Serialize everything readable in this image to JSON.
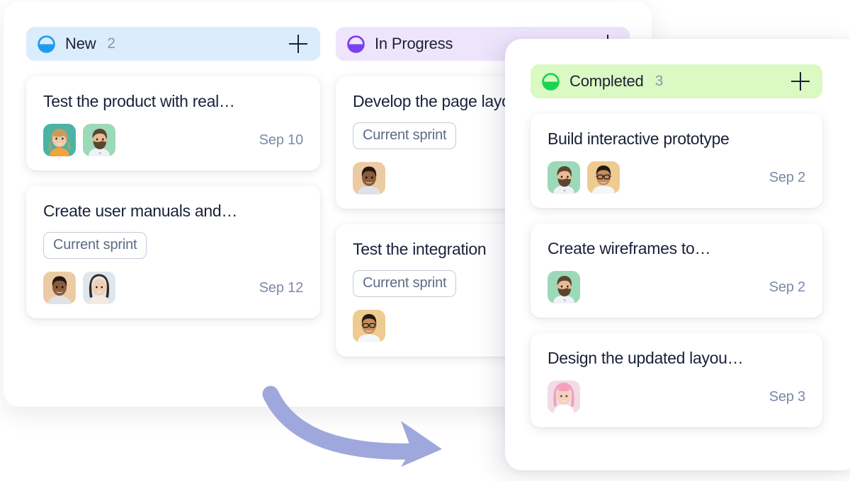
{
  "board": {
    "columns": [
      {
        "id": "new",
        "status_icon": "half-circle-status-icon",
        "accent": "#1e9bf0",
        "header_bg": "#dbecfd",
        "title": "New",
        "count": "2",
        "add_label": "+",
        "cards": [
          {
            "title": "Test the product with real…",
            "tag": null,
            "date": "Sep 10",
            "avatars": [
              {
                "name": "avatar-woman-blonde",
                "bg": "#4cb3a5",
                "skin": "#f1c9a8",
                "hair": "#c79a5e",
                "cloth": "#f2a33c"
              },
              {
                "name": "avatar-man-beard",
                "bg": "#9cd9b9",
                "skin": "#e8bb95",
                "hair": "#5c4530",
                "cloth": "#eef2f6"
              }
            ]
          },
          {
            "title": "Create user manuals and…",
            "tag": "Current sprint",
            "date": "Sep 12",
            "avatars": [
              {
                "name": "avatar-man-smiling",
                "bg": "#eccba4",
                "skin": "#8a5c3c",
                "hair": "#23160f",
                "cloth": "#dfe3e8"
              },
              {
                "name": "avatar-woman-darkhair",
                "bg": "#dfe7ee",
                "skin": "#f0d0b4",
                "hair": "#3b2a20",
                "cloth": "#f4eae2"
              }
            ]
          }
        ]
      },
      {
        "id": "in-progress",
        "status_icon": "half-circle-status-icon",
        "accent": "#7b3ff0",
        "header_bg": "#eee5fd",
        "title": "In Progress",
        "count": "",
        "add_label": "+",
        "cards": [
          {
            "title": "Develop the page layout",
            "tag": "Current sprint",
            "date": "",
            "avatars": [
              {
                "name": "avatar-man-smiling",
                "bg": "#eccba4",
                "skin": "#8a5c3c",
                "hair": "#23160f",
                "cloth": "#dfe3e8"
              }
            ]
          },
          {
            "title": "Test the integration",
            "tag": "Current sprint",
            "date": "",
            "avatars": [
              {
                "name": "avatar-man-glasses",
                "bg": "#eecb90",
                "skin": "#c58d5e",
                "hair": "#221a12",
                "cloth": "#f4f6f8"
              }
            ]
          }
        ]
      },
      {
        "id": "completed",
        "status_icon": "half-circle-status-icon",
        "accent": "#19d44e",
        "header_bg": "#dbf9c2",
        "title": "Completed",
        "count": "3",
        "add_label": "+",
        "cards": [
          {
            "title": "Build interactive prototype",
            "tag": null,
            "date": "Sep 2",
            "avatars": [
              {
                "name": "avatar-man-beard",
                "bg": "#9cd9b9",
                "skin": "#e8bb95",
                "hair": "#5c4530",
                "cloth": "#eef2f6"
              },
              {
                "name": "avatar-man-glasses",
                "bg": "#eecb90",
                "skin": "#c58d5e",
                "hair": "#221a12",
                "cloth": "#f4f6f8"
              }
            ]
          },
          {
            "title": "Create wireframes to…",
            "tag": null,
            "date": "Sep 2",
            "avatars": [
              {
                "name": "avatar-man-beard",
                "bg": "#9cd9b9",
                "skin": "#e8bb95",
                "hair": "#5c4530",
                "cloth": "#eef2f6"
              }
            ]
          },
          {
            "title": "Design the updated layou…",
            "tag": null,
            "date": "Sep 3",
            "avatars": [
              {
                "name": "avatar-woman-pinkhair",
                "bg": "#f2dce4",
                "skin": "#f3d0bd",
                "hair": "#f2a0be",
                "cloth": "#ffffff"
              }
            ]
          }
        ]
      }
    ]
  },
  "decoration": {
    "arrow": {
      "name": "curved-arrow-right",
      "color": "#9fa8dc"
    }
  }
}
